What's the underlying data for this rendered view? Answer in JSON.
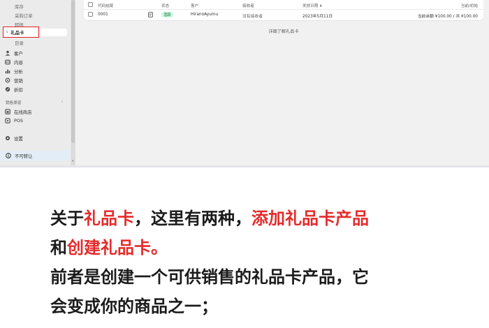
{
  "sidebar": {
    "items_top": [
      {
        "label": "库存"
      },
      {
        "label": "采购订单"
      },
      {
        "label": "转移"
      },
      {
        "label": "礼品卡"
      },
      {
        "label": "目录"
      }
    ],
    "items_main": [
      {
        "label": "客户",
        "icon": "person-icon"
      },
      {
        "label": "内容",
        "icon": "content-icon"
      },
      {
        "label": "分析",
        "icon": "analytics-icon"
      },
      {
        "label": "营销",
        "icon": "marketing-icon"
      },
      {
        "label": "折扣",
        "icon": "discount-icon"
      }
    ],
    "sales_channels_label": "销售渠道",
    "channels": [
      {
        "label": "在线商店",
        "icon": "store-icon"
      },
      {
        "label": "POS",
        "icon": "pos-icon"
      }
    ],
    "settings_label": "设置",
    "bottom_notice": "不可转让",
    "highlight_color": "#e02020"
  },
  "table": {
    "headers": {
      "code": "代码结尾",
      "status": "状态",
      "customer": "客户",
      "recipient": "接收者",
      "issued": "发放日期",
      "balance": "当前/初始"
    },
    "rows": [
      {
        "code": "0001",
        "status": "活跃",
        "customer": "HiranoAyumu",
        "recipient": "没有接收者",
        "issued": "2023年5月11日",
        "balance": "当前余额 ¥100.00 / 共 ¥100.00"
      }
    ]
  },
  "learn_more": {
    "prefix": "详细了解",
    "link": "礼品卡"
  },
  "article": {
    "line1": [
      {
        "text": "关于",
        "red": false
      },
      {
        "text": "礼品卡",
        "red": true
      },
      {
        "text": "，这里有两种，",
        "red": false
      },
      {
        "text": "添加礼品卡产品",
        "red": true
      }
    ],
    "line2": [
      {
        "text": "和",
        "red": false
      },
      {
        "text": "创建礼品卡。",
        "red": true
      }
    ],
    "line3": "前者是创建一个可供销售的礼品卡产品，它",
    "line4": "会变成你的商品之一；",
    "accent_color": "#e42b2b"
  }
}
